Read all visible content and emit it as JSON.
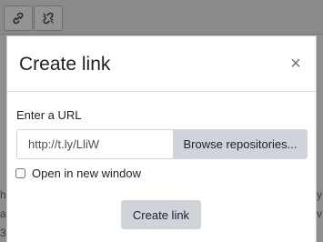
{
  "toolbar": {
    "icons": [
      "link-icon",
      "unlink-icon"
    ]
  },
  "background": {
    "left_edge_text": [
      "h",
      "a",
      "3"
    ],
    "right_edge_text": [
      "y",
      "v"
    ]
  },
  "dialog": {
    "title": "Create link",
    "close_glyph": "×",
    "url_label": "Enter a URL",
    "url_value": "http://t.ly/LliW",
    "browse_label": "Browse repositories...",
    "new_window_label": "Open in new window",
    "new_window_checked": false,
    "submit_label": "Create link"
  },
  "colors": {
    "overlay": "#8c8c8c",
    "button_bg": "#ced4da",
    "text": "#1d2125"
  }
}
